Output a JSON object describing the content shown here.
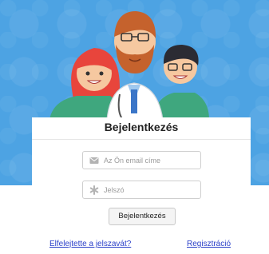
{
  "login": {
    "title": "Bejelentkezés",
    "email": {
      "placeholder": "Az Ön email címe",
      "value": "",
      "icon": "envelope-icon"
    },
    "password": {
      "placeholder": "Jelszó",
      "value": "",
      "icon": "asterisk-icon"
    },
    "submit_label": "Bejelentkezés"
  },
  "links": {
    "forgot_password": "Elfelejtette a jelszavát?",
    "register": "Regisztráció"
  },
  "colors": {
    "hero_bg": "#4da3e3",
    "link": "#2b40c9",
    "scrubs": "#3fa77e",
    "coat": "#ffffff"
  }
}
